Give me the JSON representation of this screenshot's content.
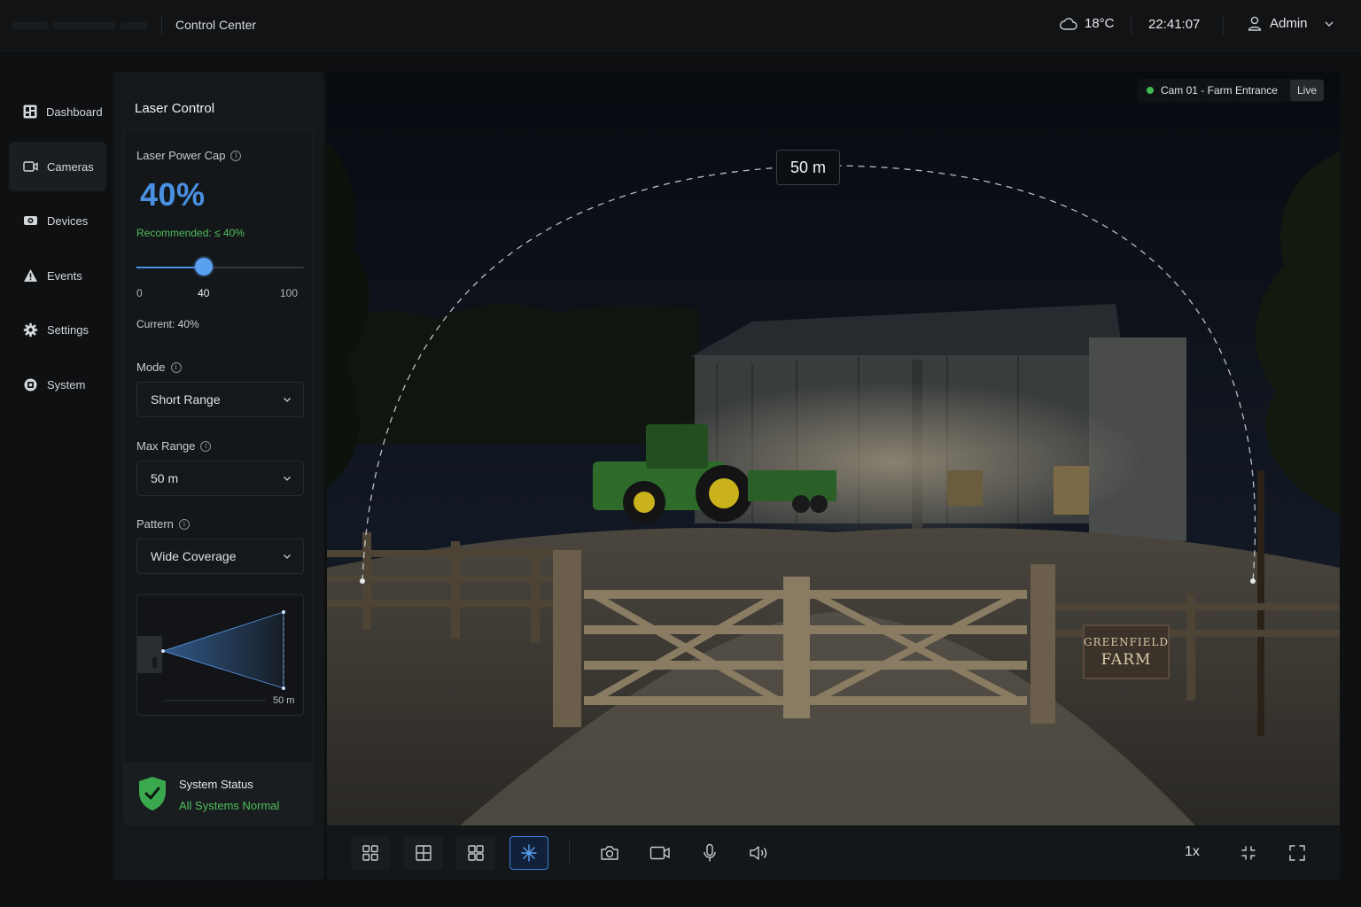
{
  "header": {
    "app_title": "Control Center",
    "weather": {
      "icon": "cloud-icon",
      "temperature": "18°C"
    },
    "time": "22:41:07",
    "user": {
      "icon": "user-icon",
      "name": "Admin"
    }
  },
  "nav": {
    "items": [
      {
        "label": "Dashboard",
        "icon": "dashboard-icon",
        "active": false
      },
      {
        "label": "Cameras",
        "icon": "camera-icon",
        "active": true
      },
      {
        "label": "Devices",
        "icon": "devices-icon",
        "active": false
      },
      {
        "label": "Events",
        "icon": "warning-icon",
        "active": false
      },
      {
        "label": "Settings",
        "icon": "gear-icon",
        "active": false
      },
      {
        "label": "System",
        "icon": "system-icon",
        "active": false
      }
    ]
  },
  "laser": {
    "title": "Laser Control",
    "power_cap": {
      "label": "Laser Power Cap",
      "value_display": "40%",
      "recommended": "Recommended: ≤ 40%",
      "slider": {
        "min": 0,
        "max": 100,
        "value": 40,
        "min_label": "0",
        "value_label": "40",
        "max_label": "100"
      },
      "current": "Current: 40%"
    },
    "mode": {
      "label": "Mode",
      "value": "Short Range"
    },
    "max_range": {
      "label": "Max Range",
      "value": "50 m"
    },
    "pattern": {
      "label": "Pattern",
      "value": "Wide Coverage",
      "preview_range_label": "50 m"
    }
  },
  "system_status": {
    "title": "System Status",
    "message": "All Systems Normal",
    "icon": "shield-check-icon",
    "color": "#4fbf5a"
  },
  "camera": {
    "name": "Cam 01 - Farm Entrance",
    "live_label": "Live",
    "range_overlay": "50 m",
    "sign": {
      "line1": "GREENFIELD",
      "line2": "FARM"
    }
  },
  "toolbar": {
    "layouts": [
      "layout-single-icon",
      "layout-quad-icon",
      "layout-multi-icon"
    ],
    "laser_toggle": {
      "icon": "laser-icon",
      "active": true
    },
    "controls": [
      "snapshot-icon",
      "record-icon",
      "microphone-icon",
      "speaker-icon"
    ],
    "zoom": "1x"
  },
  "colors": {
    "accent": "#4a90e2",
    "success": "#4fbf5a",
    "live": "#3dbb52"
  }
}
